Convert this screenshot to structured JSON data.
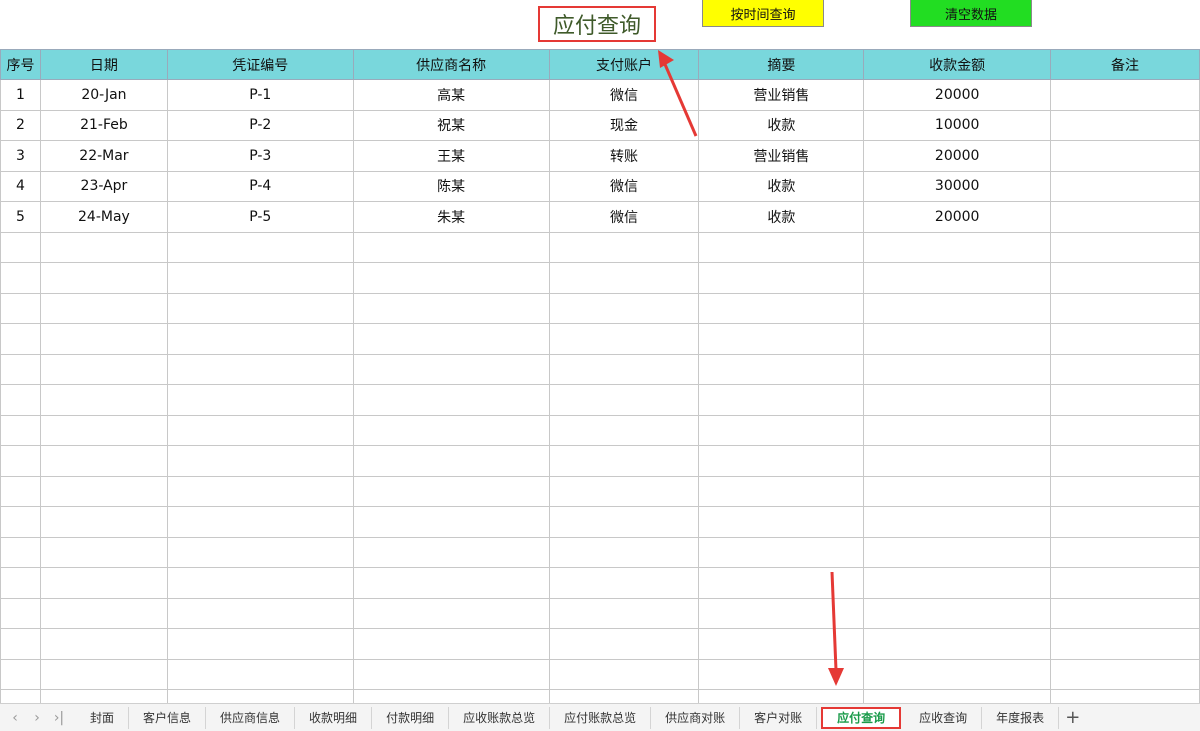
{
  "title": "应付查询",
  "buttons": {
    "by_time": "按时间查询",
    "clear": "清空数据"
  },
  "table": {
    "headers": [
      "序号",
      "日期",
      "凭证编号",
      "供应商名称",
      "支付账户",
      "摘要",
      "收款金额",
      "备注"
    ],
    "rows": [
      [
        "1",
        "20-Jan",
        "P-1",
        "高某",
        "微信",
        "营业销售",
        "20000",
        ""
      ],
      [
        "2",
        "21-Feb",
        "P-2",
        "祝某",
        "现金",
        "收款",
        "10000",
        ""
      ],
      [
        "3",
        "22-Mar",
        "P-3",
        "王某",
        "转账",
        "营业销售",
        "20000",
        ""
      ],
      [
        "4",
        "23-Apr",
        "P-4",
        "陈某",
        "微信",
        "收款",
        "30000",
        ""
      ],
      [
        "5",
        "24-May",
        "P-5",
        "朱某",
        "微信",
        "收款",
        "20000",
        ""
      ]
    ]
  },
  "sheet_tabs": [
    "封面",
    "客户信息",
    "供应商信息",
    "收款明细",
    "付款明细",
    "应收账款总览",
    "应付账款总览",
    "供应商对账",
    "客户对账",
    "应付查询",
    "应收查询",
    "年度报表"
  ],
  "active_tab": "应付查询",
  "nav_icons": [
    "prev-sheet-icon",
    "next-sheet-icon",
    "last-sheet-icon"
  ],
  "add_tab": "+",
  "colors": {
    "header_bg": "#79d7dc",
    "highlight": "#e53935",
    "btn_yellow": "#ffff00",
    "btn_green": "#22dd22",
    "active_tab_text": "#1a9b4a"
  }
}
